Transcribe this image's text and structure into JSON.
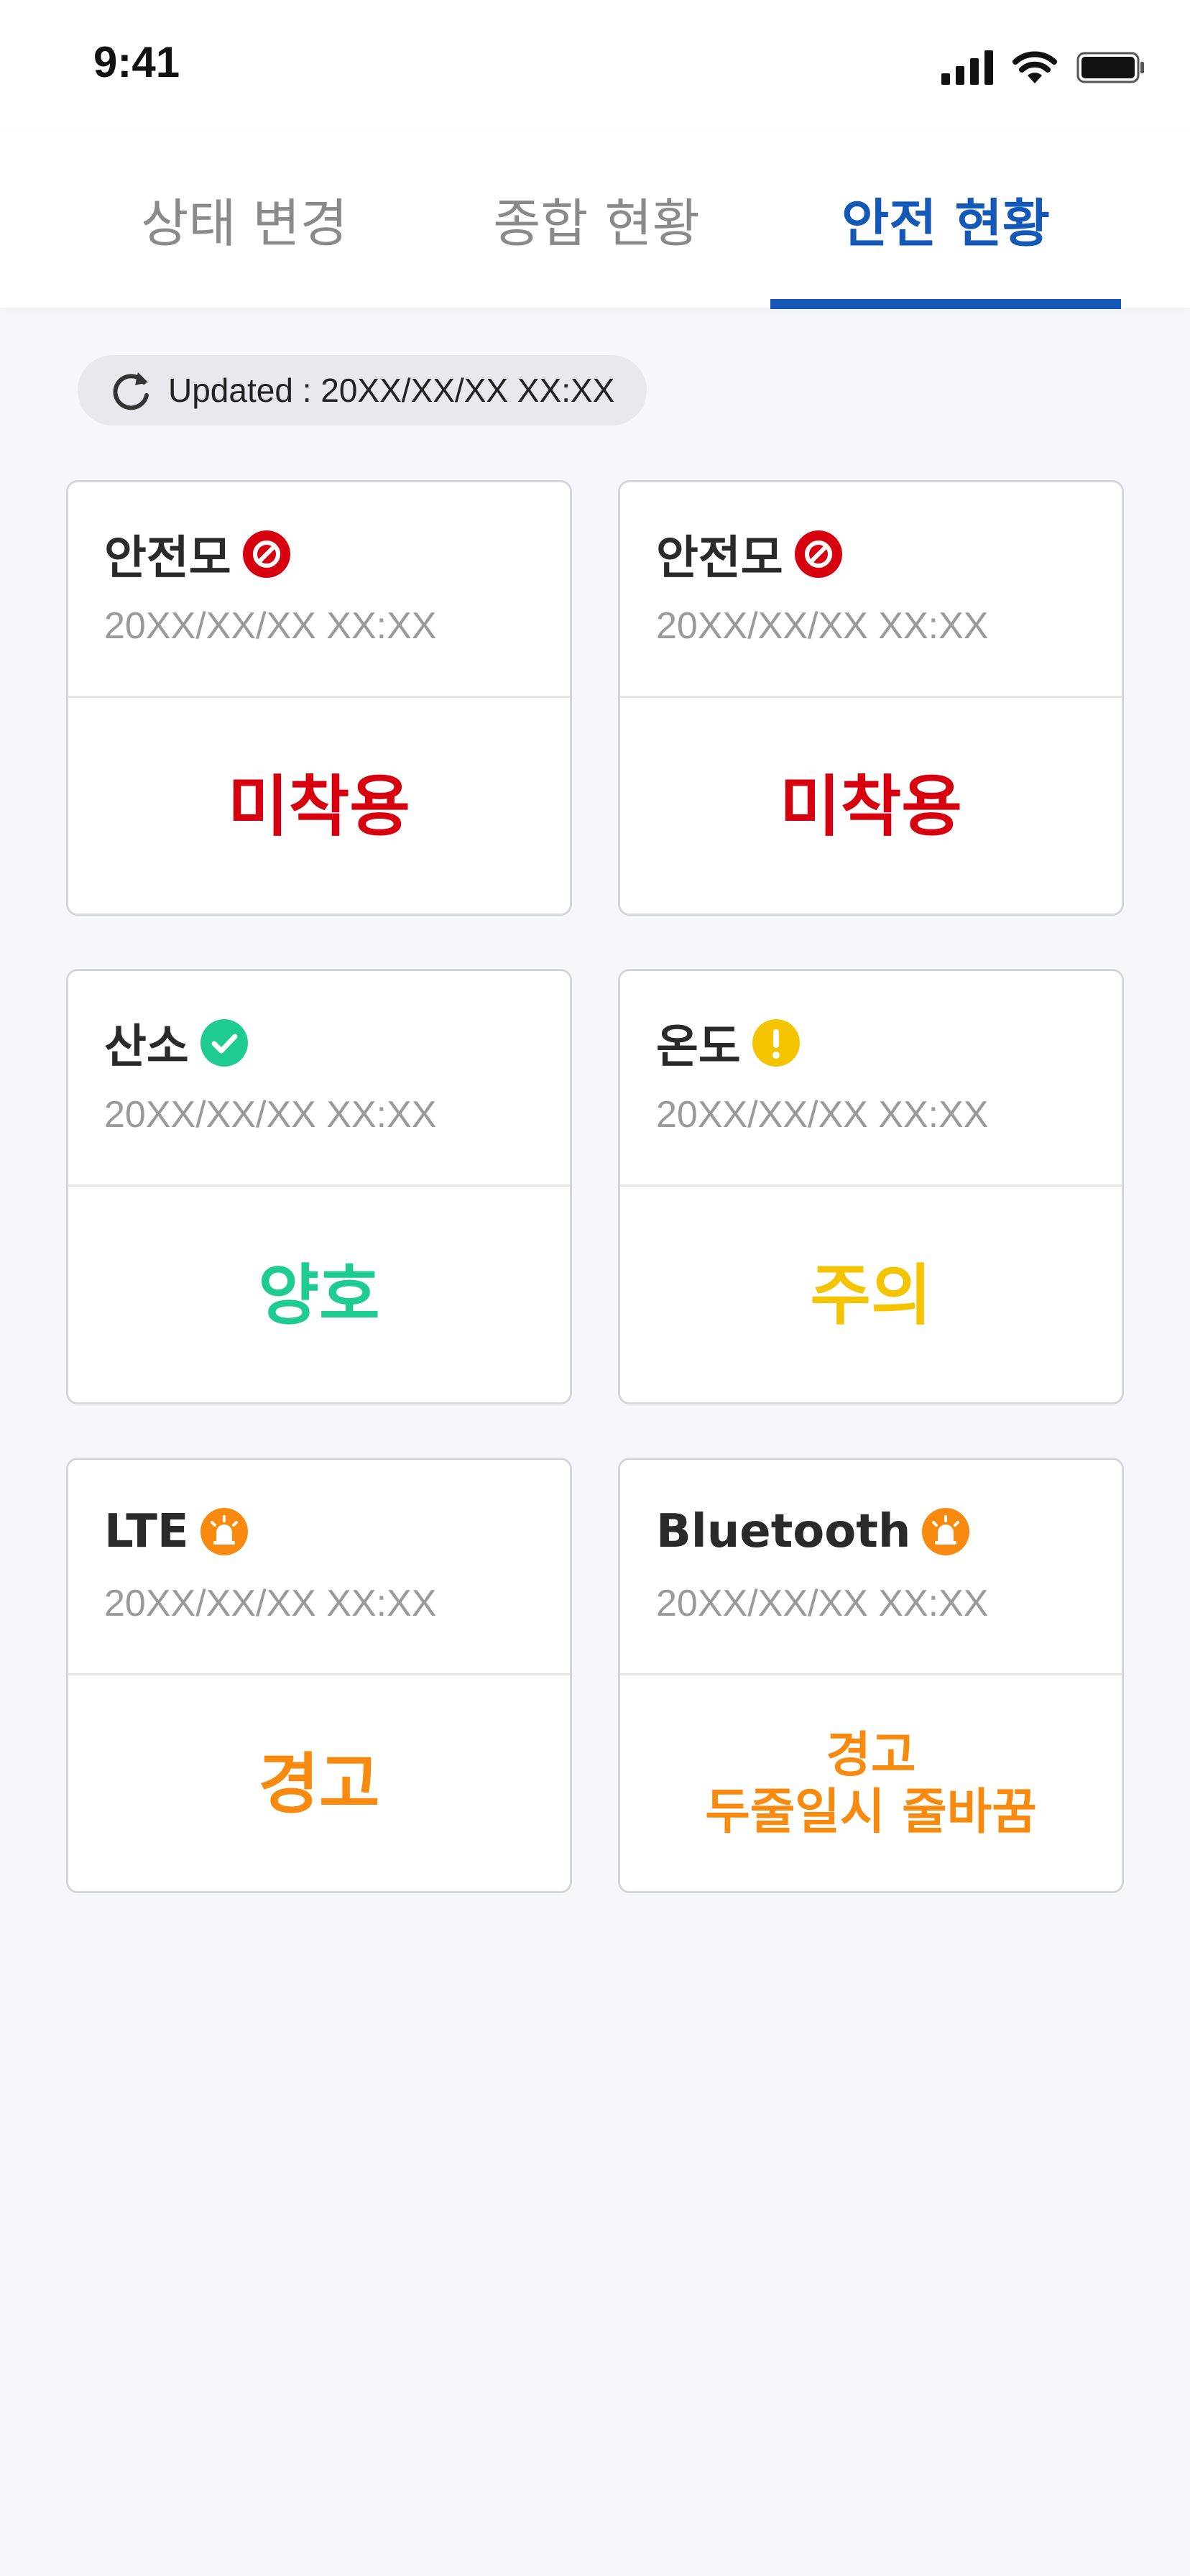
{
  "status_bar": {
    "time": "9:41"
  },
  "tabs": [
    {
      "label": "상태 변경",
      "active": false
    },
    {
      "label": "종합 현황",
      "active": false
    },
    {
      "label": "안전 현황",
      "active": true
    }
  ],
  "updated": {
    "text": "Updated : 20XX/XX/XX XX:XX"
  },
  "colors": {
    "accent": "#1458b8",
    "danger": "#d7000f",
    "good": "#1ecc92",
    "caution": "#f5c400",
    "warning": "#f98a10"
  },
  "cards": [
    {
      "title": "안전모",
      "icon": "prohibited-icon",
      "time": "20XX/XX/XX XX:XX",
      "value": "미착용",
      "status": "danger"
    },
    {
      "title": "안전모",
      "icon": "prohibited-icon",
      "time": "20XX/XX/XX XX:XX",
      "value": "미착용",
      "status": "danger"
    },
    {
      "title": "산소",
      "icon": "check-icon",
      "time": "20XX/XX/XX XX:XX",
      "value": "양호",
      "status": "good"
    },
    {
      "title": "온도",
      "icon": "exclamation-icon",
      "time": "20XX/XX/XX XX:XX",
      "value": "주의",
      "status": "caution"
    },
    {
      "title": "LTE",
      "icon": "siren-icon",
      "time": "20XX/XX/XX XX:XX",
      "value": "경고",
      "status": "warning"
    },
    {
      "title": "Bluetooth",
      "icon": "siren-icon",
      "time": "20XX/XX/XX XX:XX",
      "value": "경고\n두줄일시 줄바꿈",
      "status": "warning"
    }
  ]
}
